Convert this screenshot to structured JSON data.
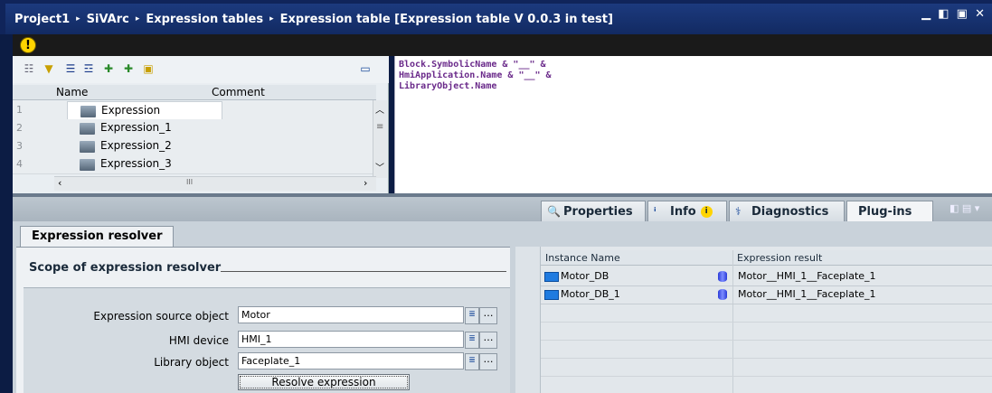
{
  "breadcrumb": [
    "Project1",
    "SiVArc",
    "Expression tables",
    "Expression table [Expression table V 0.0.3 in test]"
  ],
  "breadcrumb_separator": "▸",
  "window_controls": "▁ ◧ ▣ ✕",
  "warning_icon": "!",
  "table": {
    "columns": {
      "name": "Name",
      "comment": "Comment"
    },
    "rows": [
      {
        "num": "1",
        "name": "Expression"
      },
      {
        "num": "2",
        "name": "Expression_1"
      },
      {
        "num": "3",
        "name": "Expression_2"
      },
      {
        "num": "4",
        "name": "Expression_3"
      }
    ],
    "scroll_mark": "III"
  },
  "editor": {
    "lines": [
      "Block.SymbolicName & \"__\" &",
      "HmiApplication.Name & \"__\" &",
      "LibraryObject.Name"
    ]
  },
  "inspector_tabs": {
    "properties": "Properties",
    "info": "Info",
    "diagnostics": "Diagnostics",
    "plugins": "Plug-ins"
  },
  "plugin": {
    "subtab": "Expression resolver",
    "scope_title": "Scope of expression resolver",
    "fields": [
      {
        "label": "Expression source object",
        "value": "Motor"
      },
      {
        "label": "HMI device",
        "value": "HMI_1"
      },
      {
        "label": "Library object",
        "value": "Faceplate_1"
      }
    ],
    "resolve_button": "Resolve expression",
    "result_table": {
      "columns": {
        "instance": "Instance Name",
        "result": "Expression result"
      },
      "rows": [
        {
          "instance": "Motor_DB",
          "result": "Motor__HMI_1__Faceplate_1"
        },
        {
          "instance": "Motor_DB_1",
          "result": "Motor__HMI_1__Faceplate_1"
        }
      ]
    }
  },
  "colors": {
    "titlebar": "#1c3a7e",
    "warning": "#ffd400",
    "code": "#6a2a8a"
  }
}
